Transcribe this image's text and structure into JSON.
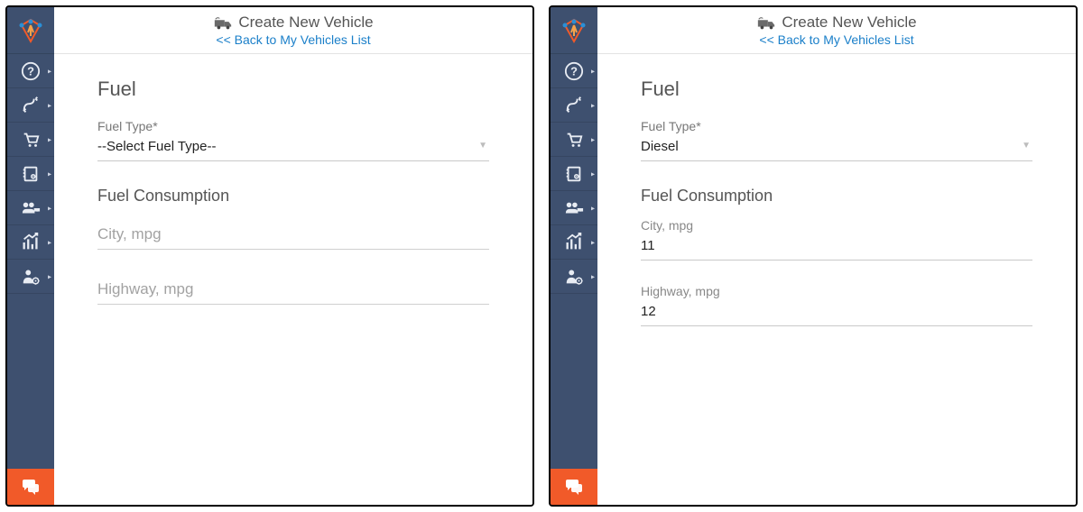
{
  "header": {
    "title": "Create New Vehicle",
    "back_link": "<< Back to My Vehicles List"
  },
  "section_fuel": "Fuel",
  "section_consumption": "Fuel Consumption",
  "labels": {
    "fuel_type": "Fuel Type*",
    "city": "City, mpg",
    "highway": "Highway, mpg"
  },
  "left": {
    "fuel_type_value": "--Select Fuel Type--",
    "city_placeholder": "City, mpg",
    "highway_placeholder": "Highway, mpg",
    "city_value": "",
    "highway_value": ""
  },
  "right": {
    "fuel_type_value": "Diesel",
    "city_value": "11",
    "highway_value": "12"
  },
  "sidebar_icons": [
    "help-icon",
    "routes-icon",
    "orders-icon",
    "addressbook-icon",
    "team-icon",
    "analytics-icon",
    "admin-icon"
  ]
}
